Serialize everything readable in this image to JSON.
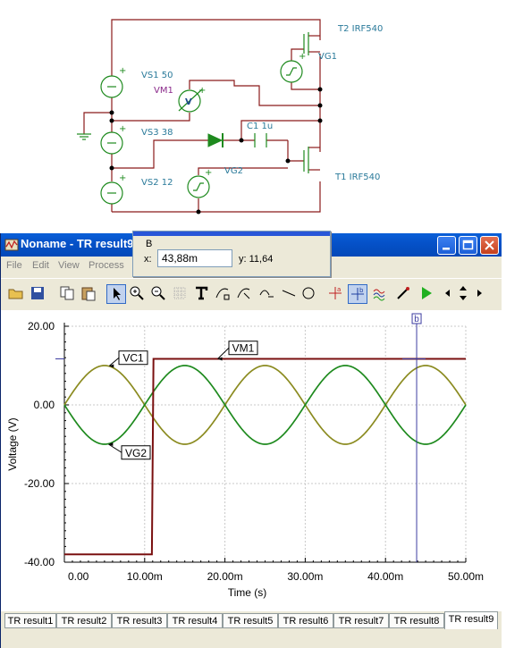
{
  "schematic": {
    "labels": {
      "t2": "T2 IRF540",
      "vg1": "VG1",
      "vs1": "VS1 50",
      "vm1": "VM1",
      "c1": "C1 1u",
      "vs3": "VS3 38",
      "vg2": "VG2",
      "t1": "T1 IRF540",
      "vs2": "VS2 12"
    },
    "meter_symbol": "V",
    "plus": "+"
  },
  "window": {
    "title": "Noname - TR result9",
    "menu": [
      "File",
      "Edit",
      "View",
      "Process"
    ]
  },
  "cursor_popup": {
    "title": "B",
    "x_label": "x:",
    "x_value": "43,88m",
    "y_label": "y:",
    "y_value": "11,64"
  },
  "colors": {
    "vc1": "#8b8b20",
    "vg2": "#1e8a1e",
    "vm1": "#7a1010",
    "cursor": "#3c3ca0",
    "title_bar": "#0553c9"
  },
  "chart_data": {
    "type": "line",
    "xlabel": "Time (s)",
    "ylabel": "Voltage (V)",
    "xlim": [
      0,
      50
    ],
    "ylim": [
      -40,
      20
    ],
    "x_ticks": [
      "0.00",
      "10.00m",
      "20.00m",
      "30.00m",
      "40.00m",
      "50.00m"
    ],
    "y_ticks": [
      "20.00",
      "0.00",
      "-20.00",
      "-40.00"
    ],
    "cursor": {
      "label": "b",
      "x": 43.88
    },
    "series": [
      {
        "name": "VC1",
        "kind": "sine",
        "amplitude": 10,
        "period_ms": 20,
        "phase": "positive-first"
      },
      {
        "name": "VG2",
        "kind": "sine",
        "amplitude": 10,
        "period_ms": 20,
        "phase": "negative-first"
      },
      {
        "name": "VM1",
        "kind": "step",
        "x": [
          0,
          10.9,
          11.1,
          50
        ],
        "y": [
          -38,
          -38,
          11.7,
          11.7
        ]
      }
    ]
  },
  "tabs": [
    "TR result1",
    "TR result2",
    "TR result3",
    "TR result4",
    "TR result5",
    "TR result6",
    "TR result7",
    "TR result8",
    "TR result9"
  ],
  "active_tab": 8
}
